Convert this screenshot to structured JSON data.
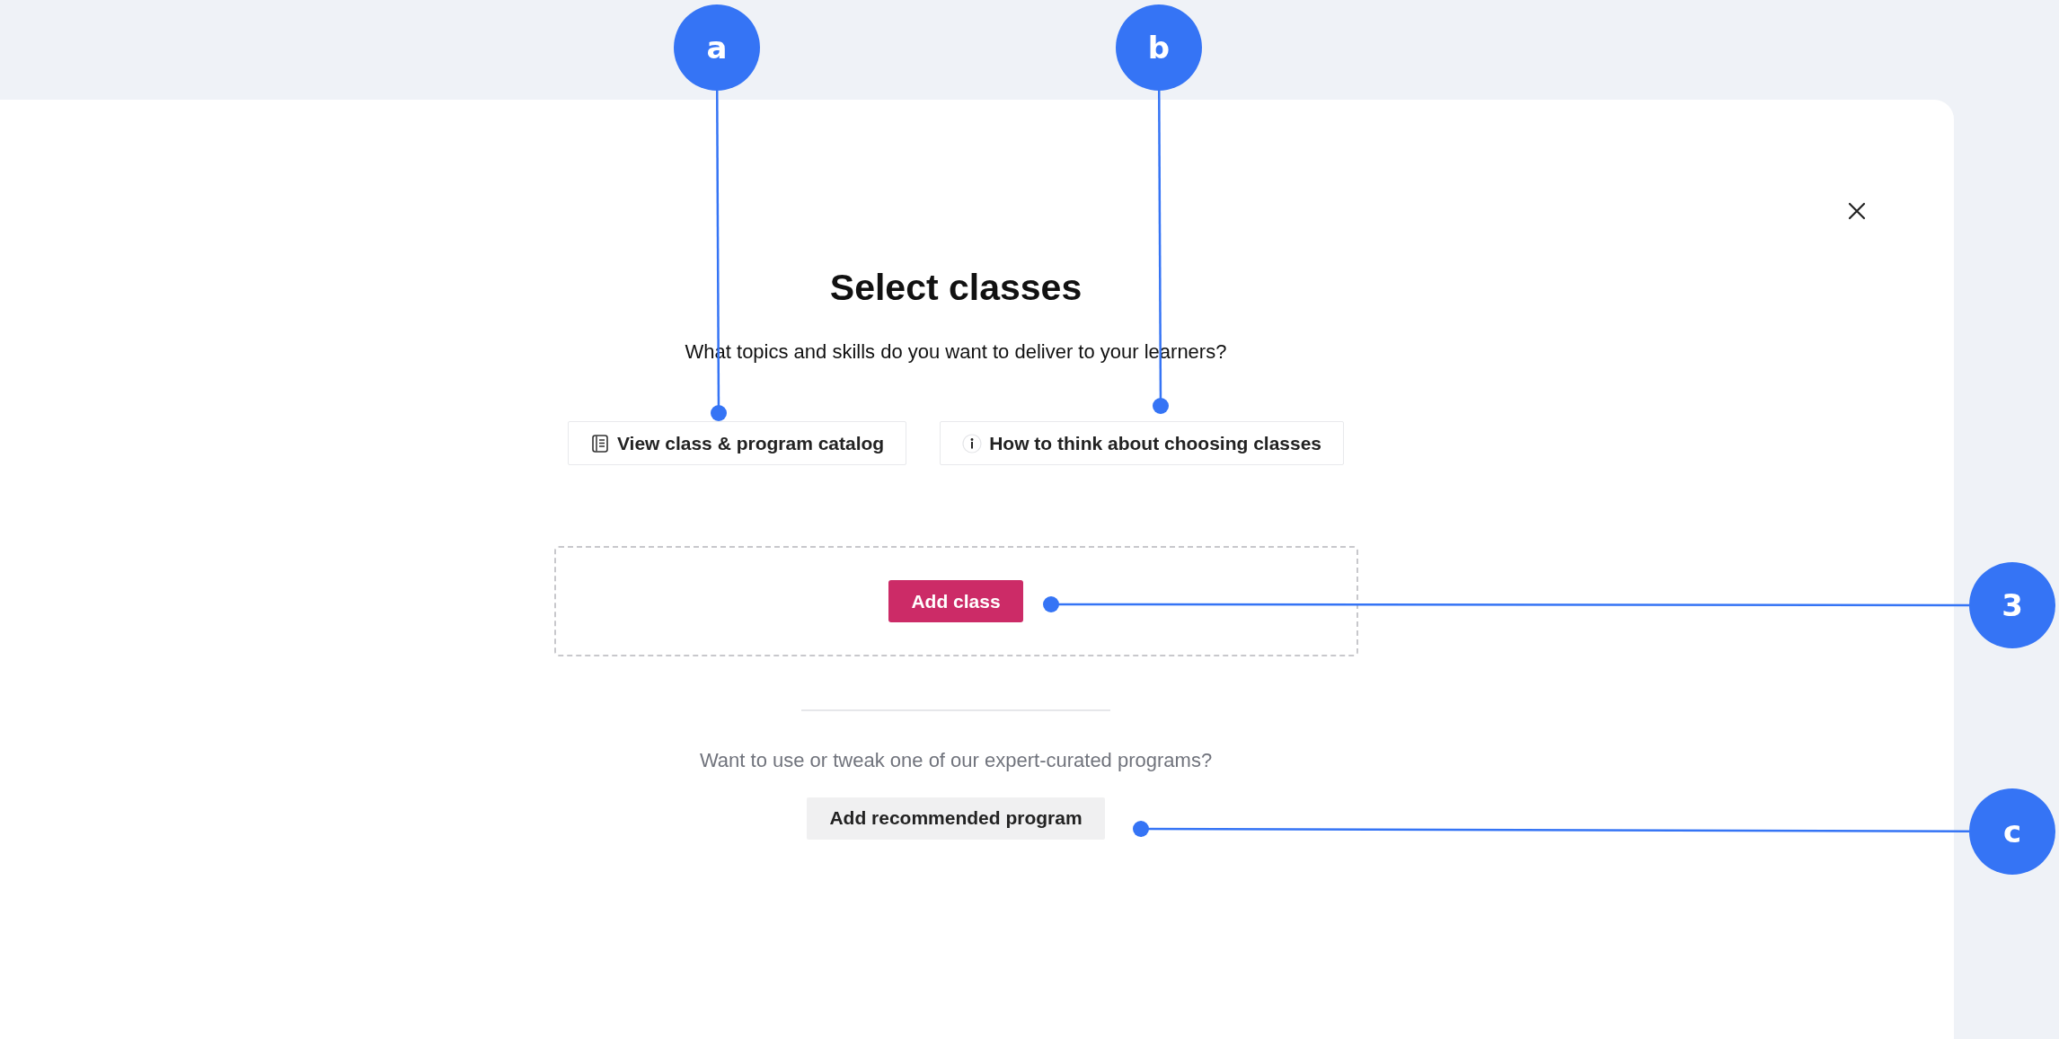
{
  "dialog": {
    "title": "Select classes",
    "subtitle": "What topics and skills do you want to deliver to your learners?",
    "links": [
      {
        "label": "View class & program catalog",
        "kind": "catalog"
      },
      {
        "label": "How to think about choosing classes",
        "kind": "info"
      }
    ],
    "primary_button": "Add class",
    "prompt": "Want to use or tweak one of our expert-curated programs?",
    "secondary_button": "Add recommended program"
  },
  "annotations": [
    {
      "label": "a"
    },
    {
      "label": "b"
    },
    {
      "label": "3"
    },
    {
      "label": "c"
    }
  ]
}
